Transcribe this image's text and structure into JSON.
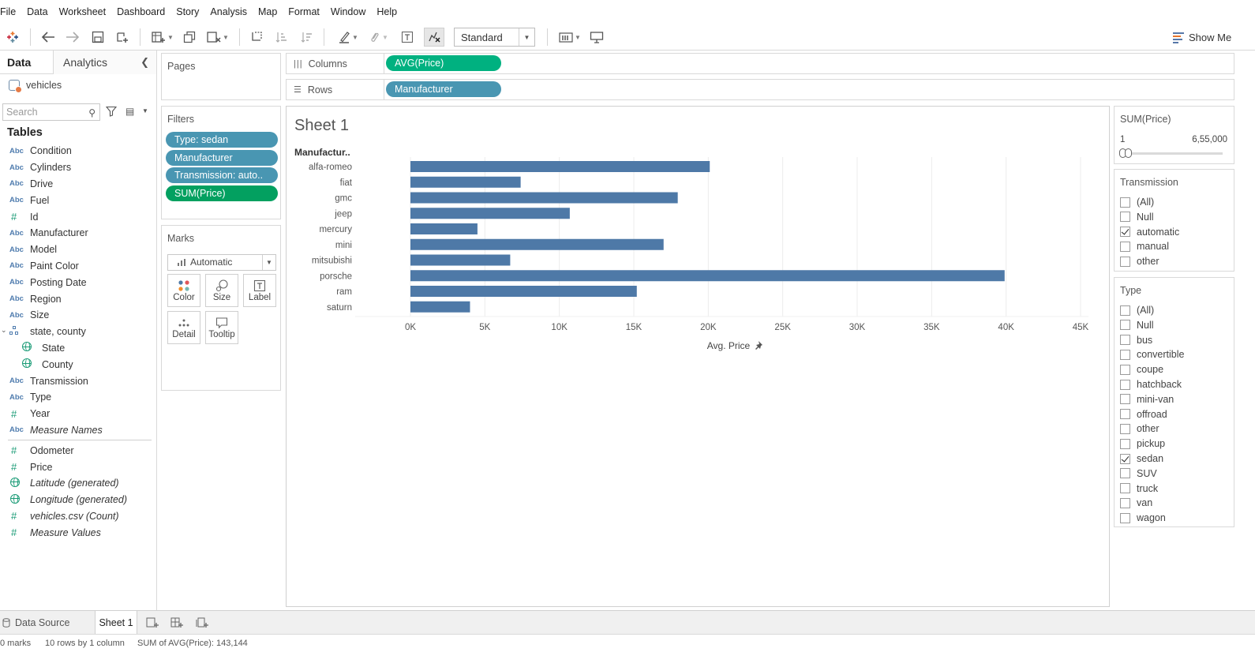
{
  "menu": [
    "File",
    "Data",
    "Worksheet",
    "Dashboard",
    "Story",
    "Analysis",
    "Map",
    "Format",
    "Window",
    "Help"
  ],
  "toolbar": {
    "fit_select": "Standard",
    "show_me": "Show Me"
  },
  "data_pane": {
    "tab_data": "Data",
    "tab_analytics": "Analytics",
    "datasource": "vehicles",
    "search_placeholder": "Search",
    "tables_header": "Tables",
    "dimensions": [
      {
        "type": "Abc",
        "name": "Condition"
      },
      {
        "type": "Abc",
        "name": "Cylinders"
      },
      {
        "type": "Abc",
        "name": "Drive"
      },
      {
        "type": "Abc",
        "name": "Fuel"
      },
      {
        "type": "#",
        "name": "Id"
      },
      {
        "type": "Abc",
        "name": "Manufacturer"
      },
      {
        "type": "Abc",
        "name": "Model"
      },
      {
        "type": "Abc",
        "name": "Paint Color"
      },
      {
        "type": "Abc",
        "name": "Posting Date"
      },
      {
        "type": "Abc",
        "name": "Region"
      },
      {
        "type": "Abc",
        "name": "Size"
      },
      {
        "type": "hier",
        "name": "state, county"
      },
      {
        "type": "globe",
        "name": "State",
        "child": true
      },
      {
        "type": "globe",
        "name": "County",
        "child": true
      },
      {
        "type": "Abc",
        "name": "Transmission"
      },
      {
        "type": "Abc",
        "name": "Type"
      },
      {
        "type": "#",
        "name": "Year"
      },
      {
        "type": "Abc",
        "name": "Measure Names",
        "italic": true
      }
    ],
    "measures": [
      {
        "type": "#",
        "name": "Odometer"
      },
      {
        "type": "#",
        "name": "Price"
      },
      {
        "type": "globe",
        "name": "Latitude (generated)",
        "italic": true
      },
      {
        "type": "globe",
        "name": "Longitude (generated)",
        "italic": true
      },
      {
        "type": "#",
        "name": "vehicles.csv (Count)",
        "italic": true
      },
      {
        "type": "#",
        "name": "Measure Values",
        "italic": true
      }
    ]
  },
  "pages_card": {
    "title": "Pages"
  },
  "filters_card": {
    "title": "Filters",
    "pills": [
      "Type: sedan",
      "Manufacturer",
      "Transmission: auto..",
      "SUM(Price)"
    ]
  },
  "marks_card": {
    "title": "Marks",
    "mark_type": "Automatic",
    "buttons": [
      "Color",
      "Size",
      "Label",
      "Detail",
      "Tooltip"
    ]
  },
  "shelves": {
    "columns_label": "Columns",
    "columns_pill": "AVG(Price)",
    "rows_label": "Rows",
    "rows_pill": "Manufacturer"
  },
  "sheet": {
    "title": "Sheet 1"
  },
  "chart_data": {
    "type": "bar",
    "orientation": "horizontal",
    "row_header": "Manufactur..",
    "categories": [
      "alfa-romeo",
      "fiat",
      "gmc",
      "jeep",
      "mercury",
      "mini",
      "mitsubishi",
      "porsche",
      "ram",
      "saturn"
    ],
    "values": [
      20100,
      7400,
      17950,
      10700,
      4500,
      17000,
      6700,
      39900,
      15200,
      4000
    ],
    "xlabel": "Avg. Price",
    "xlim": [
      0,
      45000
    ],
    "xticks": [
      0,
      5000,
      10000,
      15000,
      20000,
      25000,
      30000,
      35000,
      40000,
      45000
    ],
    "xtick_labels": [
      "0K",
      "5K",
      "10K",
      "15K",
      "20K",
      "25K",
      "30K",
      "35K",
      "40K",
      "45K"
    ],
    "bar_color": "#4e79a7",
    "grid": "vertical"
  },
  "price_filter": {
    "title": "SUM(Price)",
    "min_label": "1",
    "max_label": "6,55,000"
  },
  "transmission_filter": {
    "title": "Transmission",
    "items": [
      {
        "label": "(All)",
        "checked": false
      },
      {
        "label": "Null",
        "checked": false
      },
      {
        "label": "automatic",
        "checked": true
      },
      {
        "label": "manual",
        "checked": false
      },
      {
        "label": "other",
        "checked": false
      }
    ]
  },
  "type_filter": {
    "title": "Type",
    "items": [
      {
        "label": "(All)",
        "checked": false
      },
      {
        "label": "Null",
        "checked": false
      },
      {
        "label": "bus",
        "checked": false
      },
      {
        "label": "convertible",
        "checked": false
      },
      {
        "label": "coupe",
        "checked": false
      },
      {
        "label": "hatchback",
        "checked": false
      },
      {
        "label": "mini-van",
        "checked": false
      },
      {
        "label": "offroad",
        "checked": false
      },
      {
        "label": "other",
        "checked": false
      },
      {
        "label": "pickup",
        "checked": false
      },
      {
        "label": "sedan",
        "checked": true
      },
      {
        "label": "SUV",
        "checked": false
      },
      {
        "label": "truck",
        "checked": false
      },
      {
        "label": "van",
        "checked": false
      },
      {
        "label": "wagon",
        "checked": false
      }
    ]
  },
  "bottom_tabs": {
    "data_source": "Data Source",
    "sheet1": "Sheet 1"
  },
  "status": {
    "marks": "0 marks",
    "rows_cols": "10 rows by 1 column",
    "sum": "SUM of AVG(Price): 143,144"
  }
}
